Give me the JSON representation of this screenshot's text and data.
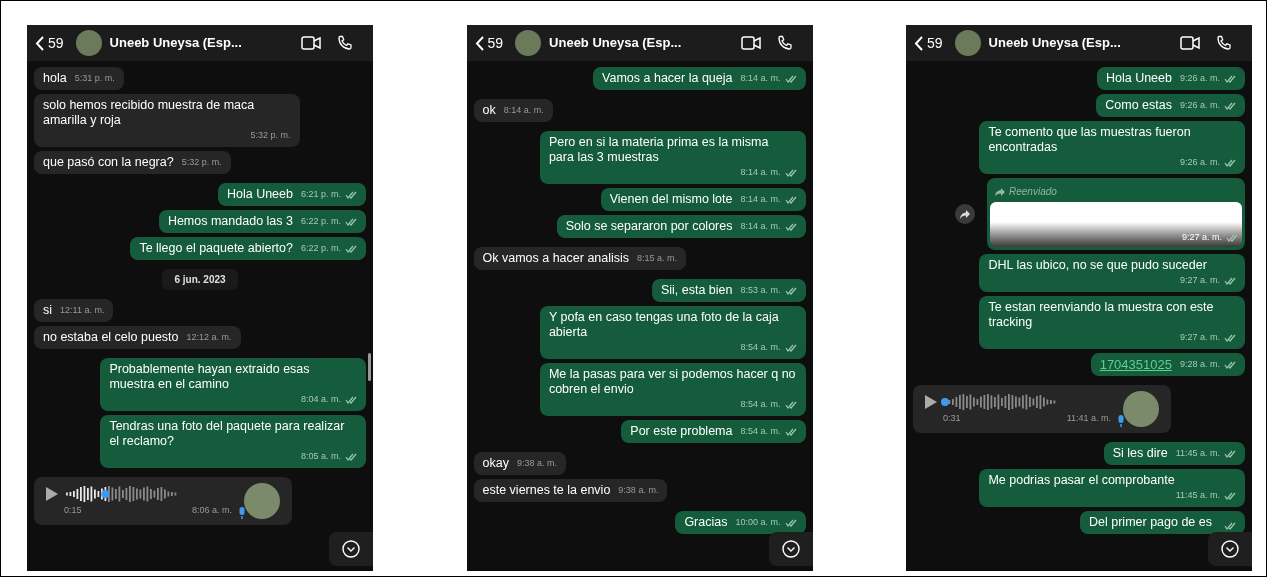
{
  "panels": [
    {
      "header": {
        "back_count": "59",
        "name": "Uneeb Uneysa (Esp..."
      },
      "scrollbar": true,
      "messages": [
        {
          "kind": "in",
          "text": "hola",
          "time": "5:31 p. m."
        },
        {
          "kind": "in",
          "text": "solo hemos recibido muestra de maca amarilla y roja",
          "time": "5:32 p. m."
        },
        {
          "kind": "in",
          "text": "que pasó con la negra?",
          "time": "5:32 p. m."
        },
        {
          "kind": "out",
          "text": "Hola Uneeb",
          "time": "6:21 p. m.",
          "read": true
        },
        {
          "kind": "out",
          "text": "Hemos mandado las 3",
          "time": "6:22 p. m.",
          "read": true
        },
        {
          "kind": "out",
          "text": "Te llego el paquete abierto?",
          "time": "6:22 p. m.",
          "read": true
        },
        {
          "kind": "date",
          "text": "6 jun. 2023"
        },
        {
          "kind": "in",
          "text": "si",
          "time": "12:11 a. m."
        },
        {
          "kind": "in",
          "text": "no estaba el celo puesto",
          "time": "12:12 a. m."
        },
        {
          "kind": "out",
          "text": "Probablemente hayan extraido esas muestra en el camino",
          "time": "8:04 a. m.",
          "read": true
        },
        {
          "kind": "out",
          "text": "Tendras una foto del paquete para realizar el reclamo?",
          "time": "8:05 a. m.",
          "read": true
        },
        {
          "kind": "voice",
          "duration": "0:15",
          "time": "8:06 a. m.",
          "level": 0.35
        }
      ]
    },
    {
      "header": {
        "back_count": "59",
        "name": "Uneeb Uneysa (Esp..."
      },
      "scrollbar": false,
      "messages": [
        {
          "kind": "out",
          "text": "Vamos a hacer la queja",
          "time": "8:14 a. m.",
          "read": true
        },
        {
          "kind": "in",
          "text": "ok",
          "time": "8:14 a. m."
        },
        {
          "kind": "out",
          "text": "Pero en si la materia prima es la misma para las 3 muestras",
          "time": "8:14 a. m.",
          "read": true
        },
        {
          "kind": "out",
          "text": "Vienen del mismo lote",
          "time": "8:14 a. m.",
          "read": true
        },
        {
          "kind": "out",
          "text": "Solo se separaron por colores",
          "time": "8:14 a. m.",
          "read": true
        },
        {
          "kind": "in",
          "text": "Ok vamos a hacer analisis",
          "time": "8:15 a. m."
        },
        {
          "kind": "out",
          "text": "Sii, esta bien",
          "time": "8:53 a. m.",
          "read": true
        },
        {
          "kind": "out",
          "text": "Y pofa en caso tengas una foto de la caja abierta",
          "time": "8:54 a. m.",
          "read": true
        },
        {
          "kind": "out",
          "text": "Me la pasas para ver si podemos hacer q no cobren el envio",
          "time": "8:54 a. m.",
          "read": true
        },
        {
          "kind": "out",
          "text": "Por este problema",
          "time": "8:54 a. m.",
          "read": true
        },
        {
          "kind": "in",
          "text": "okay",
          "time": "9:38 a. m."
        },
        {
          "kind": "in",
          "text": "este viernes te la envio",
          "time": "9:38 a. m."
        },
        {
          "kind": "out",
          "text": "Gracias",
          "time": "10:00 a. m.",
          "read": true
        }
      ]
    },
    {
      "header": {
        "back_count": "59",
        "name": "Uneeb Uneysa (Esp..."
      },
      "scrollbar": false,
      "messages": [
        {
          "kind": "out",
          "text": "Hola Uneeb",
          "time": "9:26 a. m.",
          "read": true
        },
        {
          "kind": "out",
          "text": "Como estas",
          "time": "9:26 a. m.",
          "read": true
        },
        {
          "kind": "out",
          "text": "Te comento que las muestras fueron encontradas",
          "time": "9:26 a. m.",
          "read": true
        },
        {
          "kind": "forwarded",
          "label": "Reenviado",
          "time": "9:27 a. m.",
          "read": true
        },
        {
          "kind": "out",
          "text": "DHL las ubico, no se que pudo suceder",
          "time": "9:27 a. m.",
          "read": true
        },
        {
          "kind": "out",
          "text": "Te estan reenviando la muestra con este tracking",
          "time": "9:27 a. m.",
          "read": true
        },
        {
          "kind": "link",
          "text": "1704351025",
          "time": "9:28 a. m.",
          "read": true
        },
        {
          "kind": "voice",
          "duration": "0:31",
          "time": "11:41 a. m.",
          "level": 0.0
        },
        {
          "kind": "out",
          "text": "Si les dire",
          "time": "11:45 a. m.",
          "read": true
        },
        {
          "kind": "out",
          "text": "Me podrias pasar el comprobante",
          "time": "11:45 a. m.",
          "read": true
        },
        {
          "kind": "out",
          "text": "Del primer pago de es",
          "read": true
        }
      ]
    }
  ]
}
